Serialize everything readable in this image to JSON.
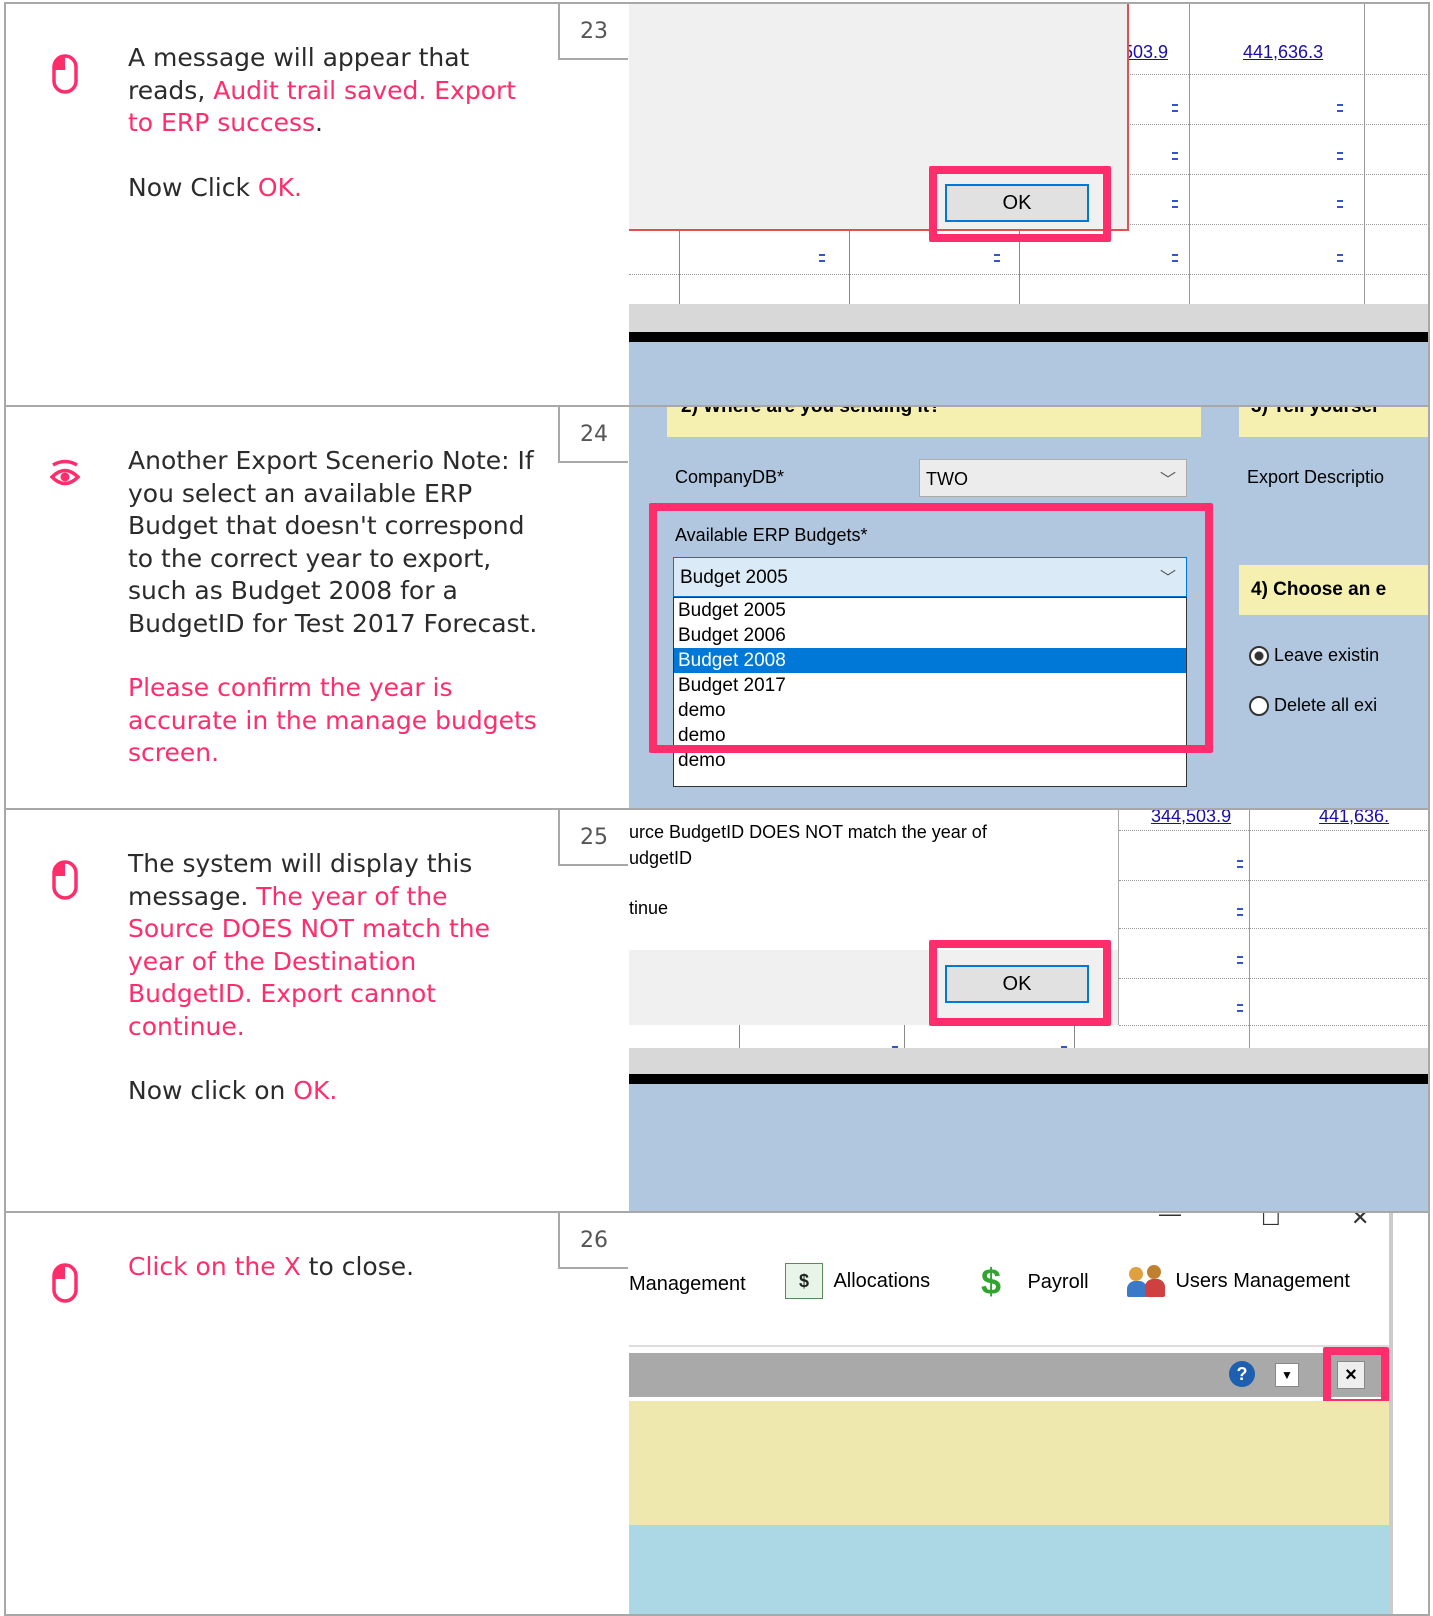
{
  "steps": [
    {
      "number": "23",
      "icon": "mouse-click-icon",
      "line1": "A message will appear that reads, ",
      "line1_highlight": "Audit trail saved. Export to ERP success",
      "line1_end": ".",
      "line2": "Now Click ",
      "line2_highlight": "OK.",
      "screenshot": {
        "values": [
          "503.9",
          "441,636.3"
        ],
        "ok_label": "OK"
      }
    },
    {
      "number": "24",
      "icon": "eye-icon",
      "line1": "Another Export Scenerio Note: If you select an available ERP Budget that doesn't correspond to the correct year to export, such as Budget 2008 for a BudgetID for Test 2017 Forecast.",
      "line2_highlight": "Please confirm the year is accurate in the manage budgets screen.",
      "screenshot": {
        "section2_title": "2) Where are you sending it?",
        "section3_title": "3) Tell yoursel",
        "company_label": "CompanyDB*",
        "company_value": "TWO",
        "export_desc_label": "Export Descriptio",
        "budgets_label": "Available ERP Budgets*",
        "selected_budget": "Budget 2005",
        "options": [
          "Budget 2005",
          "Budget 2006",
          "Budget 2008",
          "Budget 2017",
          "demo"
        ],
        "highlighted_option": "Budget 2008",
        "extra_rows": [
          "demo",
          "demo"
        ],
        "section4_title": "4) Choose an e",
        "radio1": "Leave existin",
        "radio2": "Delete all exi"
      }
    },
    {
      "number": "25",
      "icon": "mouse-click-icon",
      "line1": "The system will display this message. ",
      "line1_highlight": "The year of the Source DOES NOT match the year of the Destination BudgetID. Export cannot continue.",
      "line2": "Now click on ",
      "line2_highlight": "OK.",
      "screenshot": {
        "msg_line1": "urce BudgetID DOES NOT match the year of",
        "msg_line2": "udgetID",
        "msg_line3": "tinue",
        "values": [
          "344,503.9",
          "441,636."
        ],
        "ok_label": "OK"
      }
    },
    {
      "number": "26",
      "icon": "mouse-click-icon",
      "line1_highlight": "Click on the X",
      "line1_end": " to close.",
      "screenshot": {
        "menu_items": [
          "Management",
          "Allocations",
          "Payroll",
          "Users Management"
        ],
        "window_buttons": [
          "—",
          "☐",
          "✕"
        ]
      }
    }
  ]
}
